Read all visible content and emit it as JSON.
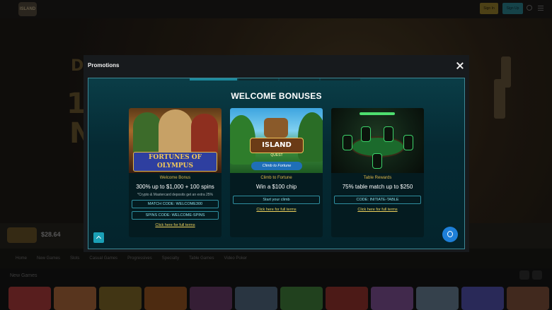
{
  "background": {
    "logo": "ISLAND",
    "header_btn_1": "Sign In",
    "header_btn_2": "Sign Up",
    "hero_text_1": "D",
    "hero_text_2": "1",
    "hero_text_3": "N",
    "balance": "$28.64",
    "nav": [
      "Home",
      "New Games",
      "Slots",
      "Casual Games",
      "Progressives",
      "Specialty",
      "Table Games",
      "Video Poker"
    ],
    "section_title": "New Games"
  },
  "modal": {
    "title": "Promotions",
    "heading": "WELCOME BONUSES",
    "cards": [
      {
        "art_title": "FORTUNES OF OLYMPUS",
        "kicker": "Welcome Bonus",
        "headline": "300% up to $1,000 + 100 spins",
        "note": "*Crypto & Mastercard deposits get an extra 25%",
        "code_1": "MATCH CODE: WELCOME300",
        "code_2": "SPINS CODE: WELCOME-SPINS",
        "link": "Click here for full terms"
      },
      {
        "art_title": "ISLAND",
        "art_title_2": "QUEST",
        "art_sub": "Climb to Fortune",
        "kicker": "Climb to Fortune",
        "headline": "Win a $100 chip",
        "code_1": "Start your climb",
        "link": "Click here for full terms"
      },
      {
        "kicker": "Table Rewards",
        "headline": "75% table match up to $250",
        "code_1": "CODE: INITIATE-TABLE",
        "link": "Click here for full terms"
      }
    ]
  },
  "colors": {
    "accent": "#1aa0b6",
    "kicker_gold": "#ddb84a",
    "link_yellow": "#f0d35c",
    "chat_blue": "#1e7fd8"
  }
}
